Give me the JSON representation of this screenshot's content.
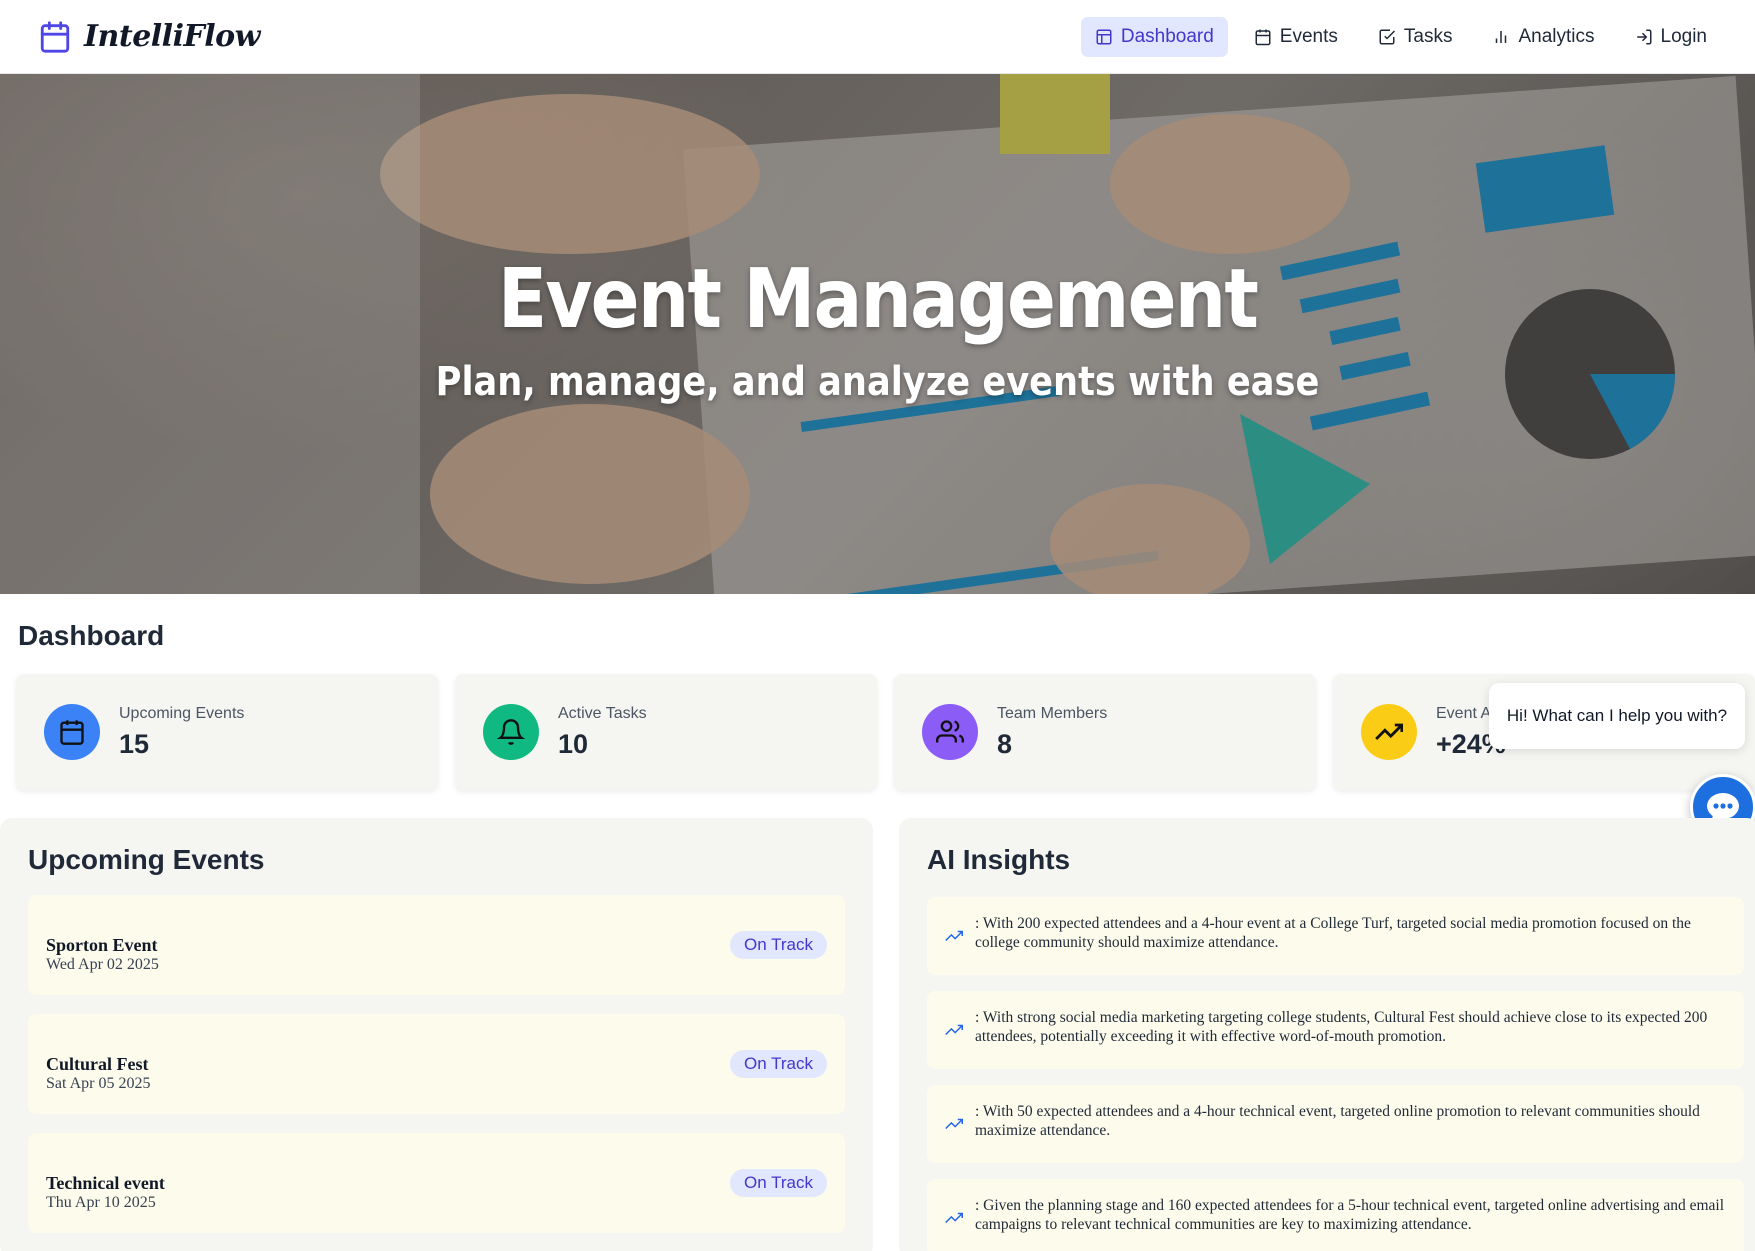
{
  "brand": {
    "name": "IntelliFlow",
    "icon": "calendar-icon",
    "accent": "#4f46e5"
  },
  "nav": {
    "items": [
      {
        "label": "Dashboard",
        "icon": "layout-icon",
        "active": true
      },
      {
        "label": "Events",
        "icon": "calendar-icon",
        "active": false
      },
      {
        "label": "Tasks",
        "icon": "checkbox-icon",
        "active": false
      },
      {
        "label": "Analytics",
        "icon": "bar-chart-icon",
        "active": false
      },
      {
        "label": "Login",
        "icon": "login-icon",
        "active": false
      }
    ]
  },
  "hero": {
    "title": "Event Management",
    "subtitle": "Plan, manage, and analyze events with ease"
  },
  "dashboard": {
    "title": "Dashboard",
    "stats": [
      {
        "label": "Upcoming Events",
        "value": "15",
        "icon": "calendar-icon",
        "color": "#3b82f6"
      },
      {
        "label": "Active Tasks",
        "value": "10",
        "icon": "bell-icon",
        "color": "#10b981"
      },
      {
        "label": "Team Members",
        "value": "8",
        "icon": "users-icon",
        "color": "#8b5cf6"
      },
      {
        "label": "Event A",
        "value": "+24%",
        "icon": "trending-up-icon",
        "color": "#facc15"
      }
    ]
  },
  "chat": {
    "greeting": "Hi! What can I help you with?",
    "icon": "chat-icon",
    "color": "#1d6fe0"
  },
  "upcoming": {
    "title": "Upcoming Events",
    "events": [
      {
        "name": "Sporton Event",
        "date": "Wed Apr 02 2025",
        "status": "On Track"
      },
      {
        "name": "Cultural Fest",
        "date": "Sat Apr 05 2025",
        "status": "On Track"
      },
      {
        "name": "Technical event",
        "date": "Thu Apr 10 2025",
        "status": "On Track"
      }
    ]
  },
  "insights": {
    "title": "AI Insights",
    "items": [
      {
        "text": ": With 200 expected attendees and a 4-hour event at a College Turf, targeted social media promotion focused on the college community should maximize attendance."
      },
      {
        "text": ": With strong social media marketing targeting college students, Cultural Fest should achieve close to its expected 200 attendees, potentially exceeding it with effective word-of-mouth promotion."
      },
      {
        "text": ": With 50 expected attendees and a 4-hour technical event, targeted online promotion to relevant communities should maximize attendance."
      },
      {
        "text": ": Given the planning stage and 160 expected attendees for a 5-hour technical event, targeted online advertising and email campaigns to relevant technical communities are key to maximizing attendance."
      }
    ]
  }
}
